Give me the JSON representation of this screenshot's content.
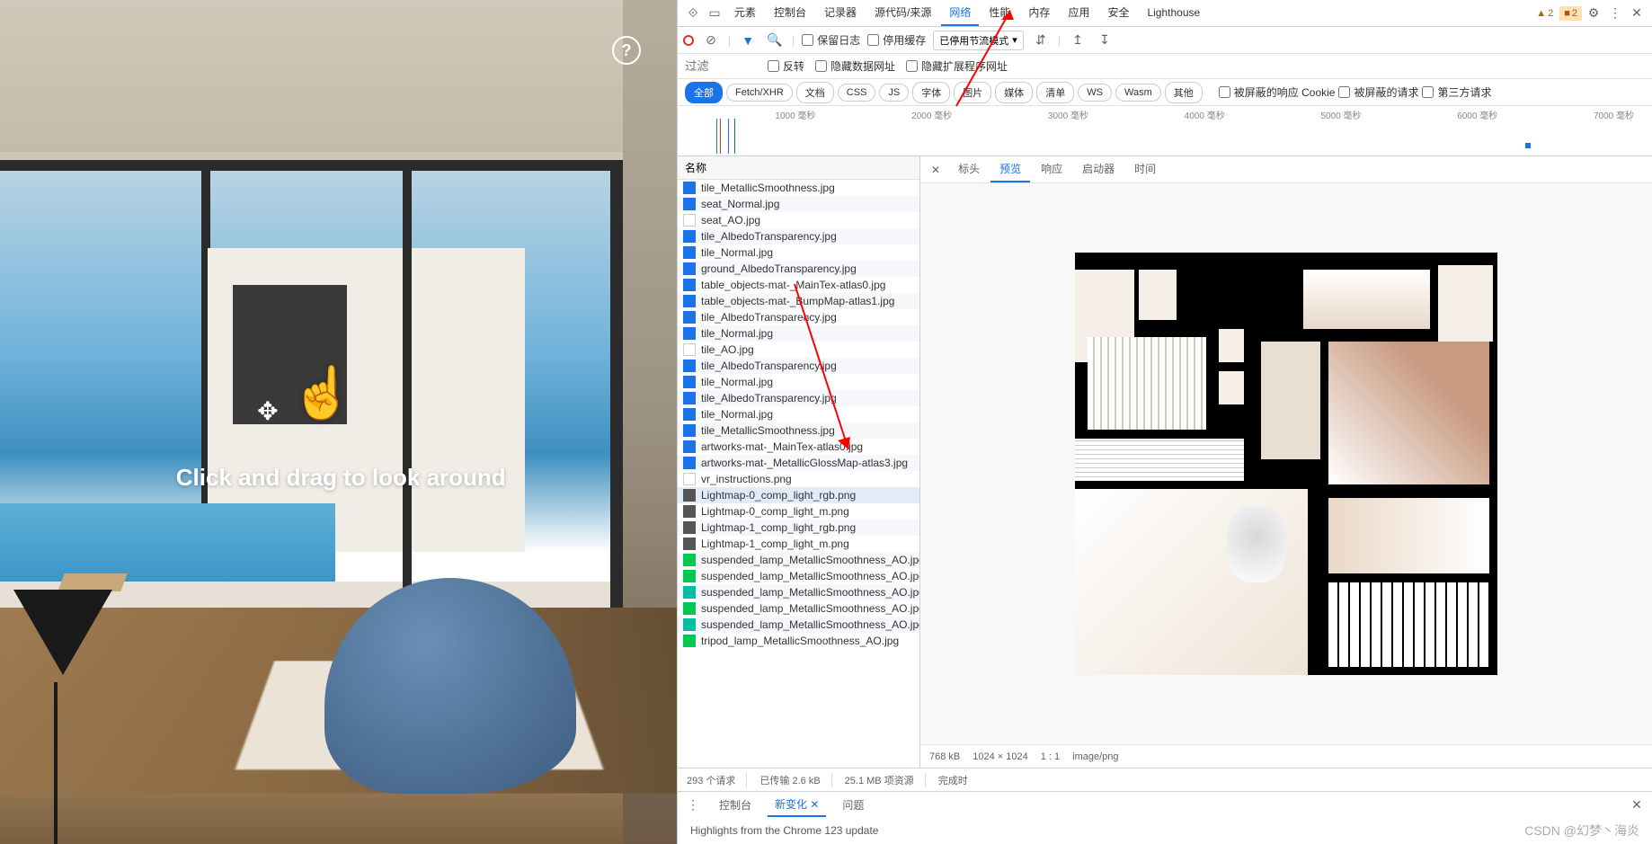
{
  "left": {
    "drag_text": "Click and drag to look around",
    "help": "?"
  },
  "devtools": {
    "tabs": [
      "元素",
      "控制台",
      "记录器",
      "源代码/来源",
      "网络",
      "性能",
      "内存",
      "应用",
      "安全",
      "Lighthouse"
    ],
    "active_tab": "网络",
    "warnings": {
      "warn_count": "2",
      "issue_count": "2"
    },
    "toolbar": {
      "preserve_log": "保留日志",
      "disable_cache": "停用缓存",
      "throttling": "已停用节流模式",
      "filter_placeholder": "过滤",
      "invert": "反转",
      "hide_data_urls": "隐藏数据网址",
      "hide_ext_urls": "隐藏扩展程序网址"
    },
    "pills": [
      "全部",
      "Fetch/XHR",
      "文档",
      "CSS",
      "JS",
      "字体",
      "图片",
      "媒体",
      "清单",
      "WS",
      "Wasm",
      "其他"
    ],
    "pill_checks": {
      "blocked_cookie": "被屏蔽的响应 Cookie",
      "blocked_req": "被屏蔽的请求",
      "third_party": "第三方请求"
    },
    "timeline_ticks": [
      "1000 毫秒",
      "2000 毫秒",
      "3000 毫秒",
      "4000 毫秒",
      "5000 毫秒",
      "6000 毫秒",
      "7000 毫秒"
    ],
    "name_header": "名称",
    "requests": [
      {
        "n": "tile_MetallicSmoothness.jpg",
        "t": "jpg"
      },
      {
        "n": "seat_Normal.jpg",
        "t": "jpg"
      },
      {
        "n": "seat_AO.jpg",
        "t": "blank"
      },
      {
        "n": "tile_AlbedoTransparency.jpg",
        "t": "jpg"
      },
      {
        "n": "tile_Normal.jpg",
        "t": "jpg"
      },
      {
        "n": "ground_AlbedoTransparency.jpg",
        "t": "jpg"
      },
      {
        "n": "table_objects-mat-_MainTex-atlas0.jpg",
        "t": "jpg"
      },
      {
        "n": "table_objects-mat-_BumpMap-atlas1.jpg",
        "t": "jpg"
      },
      {
        "n": "tile_AlbedoTransparency.jpg",
        "t": "jpg"
      },
      {
        "n": "tile_Normal.jpg",
        "t": "jpg"
      },
      {
        "n": "tile_AO.jpg",
        "t": "blank"
      },
      {
        "n": "tile_AlbedoTransparency.jpg",
        "t": "jpg"
      },
      {
        "n": "tile_Normal.jpg",
        "t": "jpg"
      },
      {
        "n": "tile_AlbedoTransparency.jpg",
        "t": "jpg"
      },
      {
        "n": "tile_Normal.jpg",
        "t": "jpg"
      },
      {
        "n": "tile_MetallicSmoothness.jpg",
        "t": "jpg"
      },
      {
        "n": "artworks-mat-_MainTex-atlas0.jpg",
        "t": "jpg"
      },
      {
        "n": "artworks-mat-_MetallicGlossMap-atlas3.jpg",
        "t": "jpg"
      },
      {
        "n": "vr_instructions.png",
        "t": "blank"
      },
      {
        "n": "Lightmap-0_comp_light_rgb.png",
        "t": "png",
        "sel": true
      },
      {
        "n": "Lightmap-0_comp_light_m.png",
        "t": "png"
      },
      {
        "n": "Lightmap-1_comp_light_rgb.png",
        "t": "png"
      },
      {
        "n": "Lightmap-1_comp_light_m.png",
        "t": "png"
      },
      {
        "n": "suspended_lamp_MetallicSmoothness_AO.jpg",
        "t": "sm"
      },
      {
        "n": "suspended_lamp_MetallicSmoothness_AO.jpg",
        "t": "sm"
      },
      {
        "n": "suspended_lamp_MetallicSmoothness_AO.jpg",
        "t": "sm2"
      },
      {
        "n": "suspended_lamp_MetallicSmoothness_AO.jpg",
        "t": "sm"
      },
      {
        "n": "suspended_lamp_MetallicSmoothness_AO.jpg",
        "t": "sm2"
      },
      {
        "n": "tripod_lamp_MetallicSmoothness_AO.jpg",
        "t": "sm"
      }
    ],
    "detail_tabs": [
      "标头",
      "预览",
      "响应",
      "启动器",
      "时间"
    ],
    "detail_active": "预览",
    "detail_foot": {
      "size": "768 kB",
      "dims": "1024 × 1024",
      "ratio": "1 : 1",
      "mime": "image/png"
    },
    "status": {
      "requests": "293 个请求",
      "transferred": "已传输 2.6 kB",
      "resources": "25.1 MB 项资源",
      "finish_label": "完成时"
    },
    "drawer": {
      "tabs": [
        "控制台",
        "新变化",
        "问题"
      ],
      "active": "新变化",
      "body": "Highlights from the Chrome 123 update"
    },
    "watermark": "CSDN @幻梦丶海炎"
  }
}
